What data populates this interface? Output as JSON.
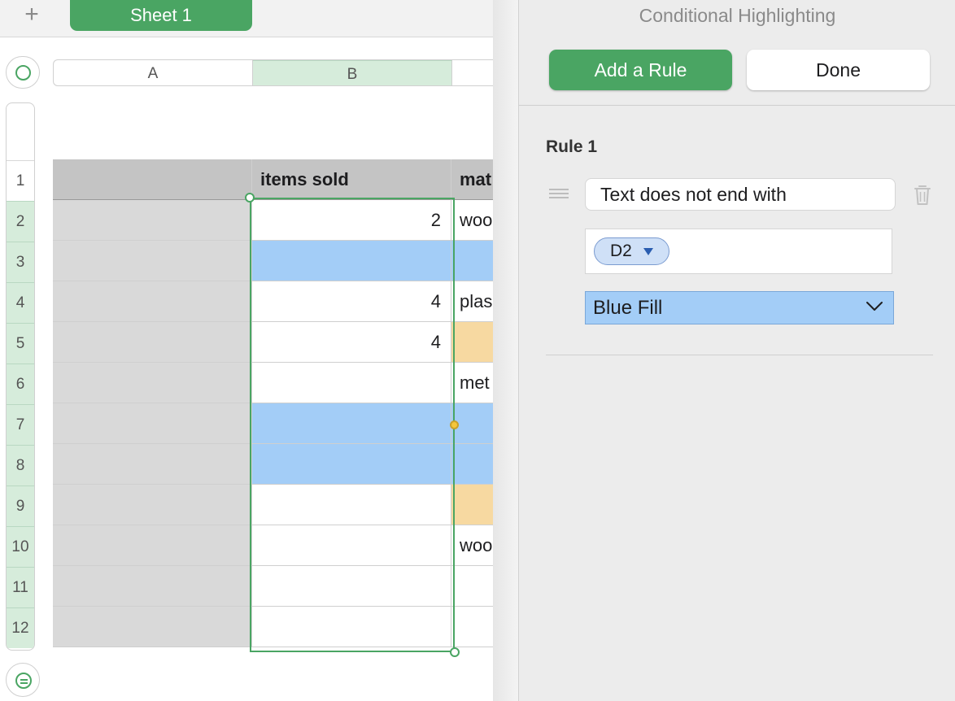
{
  "toolbar": {
    "add_sheet": "+",
    "sheet_tab": "Sheet 1"
  },
  "columns": [
    "A",
    "B"
  ],
  "rows": [
    "1",
    "2",
    "3",
    "4",
    "5",
    "6",
    "7",
    "8",
    "9",
    "10",
    "11",
    "12"
  ],
  "table": {
    "header": {
      "col_b": "items sold",
      "col_c": "mat"
    },
    "cells_b": {
      "r2": "2",
      "r4": "4",
      "r5": "4"
    },
    "cells_c": {
      "r2": "woo",
      "r4": "plas",
      "r6": "met",
      "r10": "woo"
    }
  },
  "colors": {
    "accent": "#4aa563",
    "blue_fill": "#a3cdf7",
    "orange_fill": "#f7d9a1",
    "header_fill": "#c4c4c4"
  },
  "panel": {
    "title": "Conditional Highlighting",
    "add_rule": "Add a Rule",
    "done": "Done",
    "rule": {
      "title": "Rule 1",
      "condition": "Text does not end with",
      "reference": "D2",
      "style": "Blue Fill"
    }
  },
  "icons": [
    "plus-icon",
    "select-all-icon",
    "add-row-icon",
    "drag-handle-icon",
    "trash-icon",
    "chevron-down-icon",
    "triangle-down-icon"
  ]
}
